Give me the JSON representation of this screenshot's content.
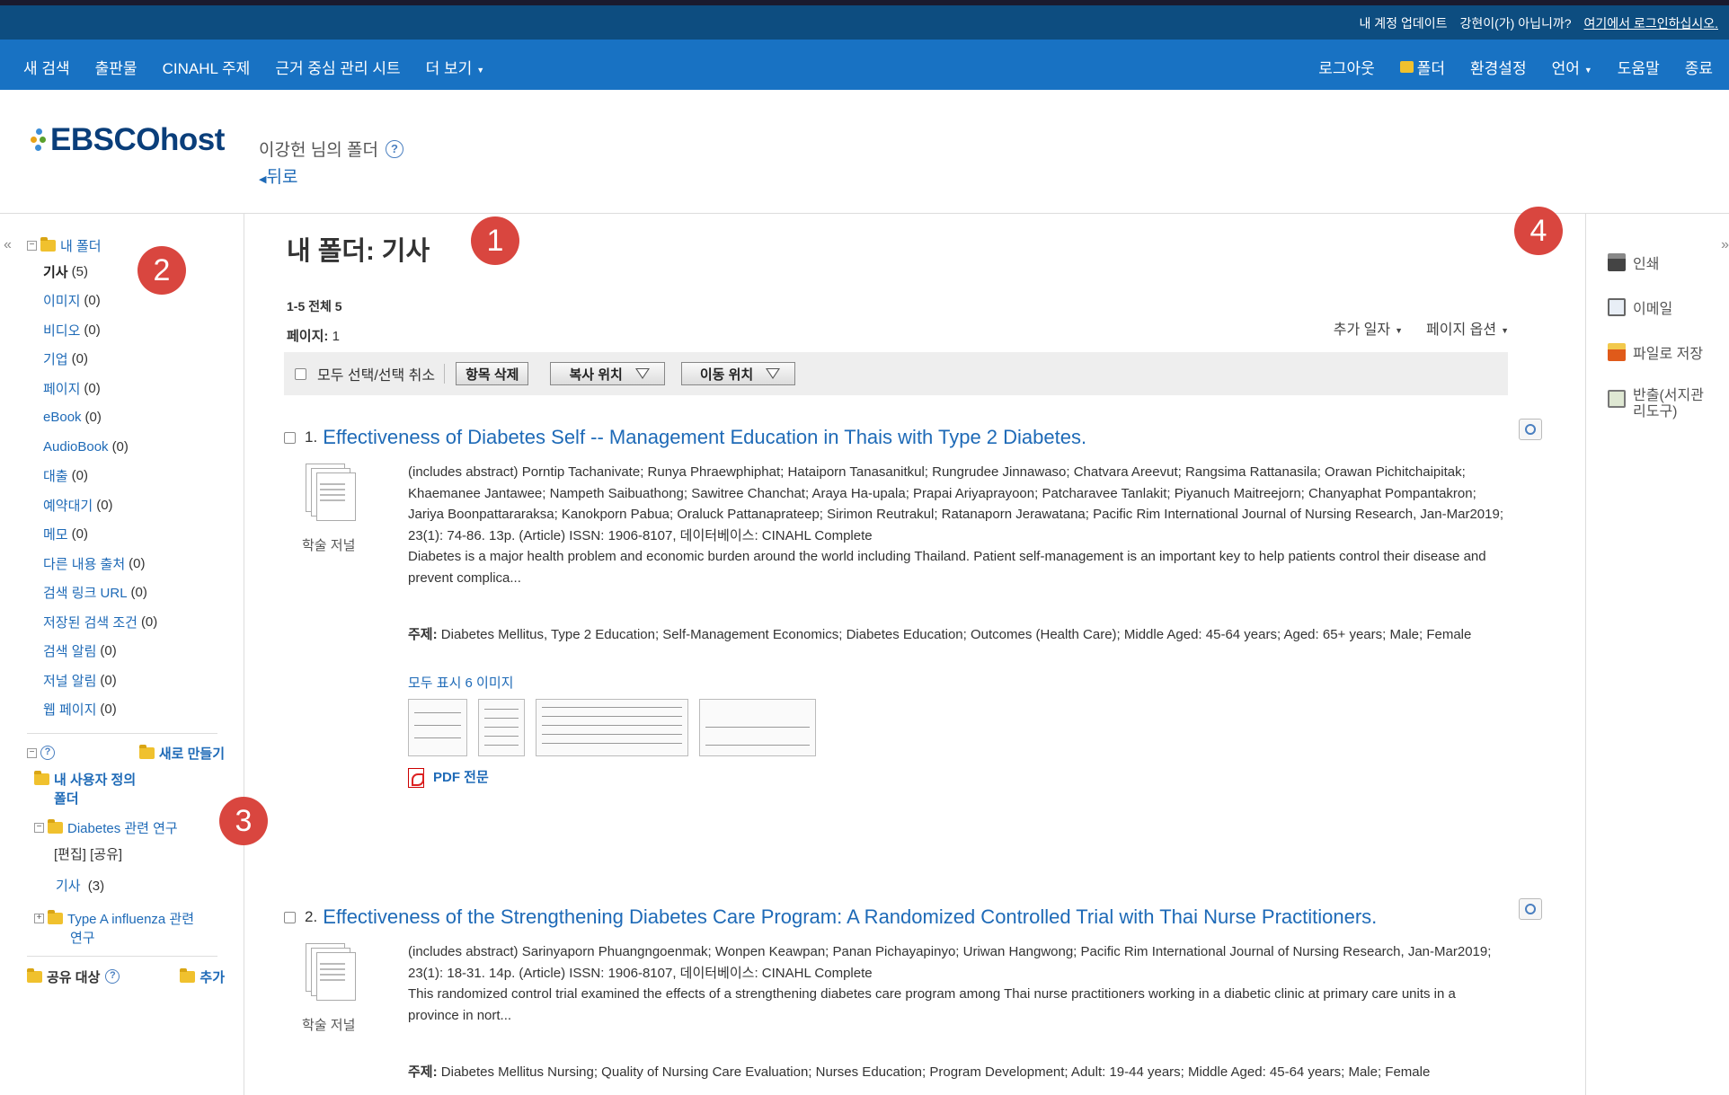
{
  "utilbar": {
    "update_account": "내 계정 업데이트",
    "not_user": "강현이(가) 아닙니까?",
    "login_here": "여기에서 로그인하십시오."
  },
  "nav": {
    "left": [
      "새 검색",
      "출판물",
      "CINAHL 주제",
      "근거 중심 관리 시트",
      "더 보기"
    ],
    "right": [
      "로그아웃",
      "폴더",
      "환경설정",
      "언어",
      "도움말",
      "종료"
    ]
  },
  "header": {
    "logo": "EBSCOhost",
    "folder_title": "이강헌 님의 폴더",
    "help": "?",
    "back": "뒤로"
  },
  "sidebar": {
    "collapse": "«",
    "my_folder": "내 폴더",
    "items": [
      {
        "label": "기사",
        "count": "(5)",
        "active": true
      },
      {
        "label": "이미지",
        "count": "(0)"
      },
      {
        "label": "비디오",
        "count": "(0)"
      },
      {
        "label": "기업",
        "count": "(0)"
      },
      {
        "label": "페이지",
        "count": "(0)"
      },
      {
        "label": "eBook",
        "count": "(0)"
      },
      {
        "label": "AudioBook",
        "count": "(0)"
      },
      {
        "label": "대출",
        "count": "(0)"
      },
      {
        "label": "예약대기",
        "count": "(0)"
      },
      {
        "label": "메모",
        "count": "(0)"
      },
      {
        "label": "다른 내용 출처",
        "count": "(0)"
      },
      {
        "label": "검색 링크 URL",
        "count": "(0)"
      },
      {
        "label": "저장된 검색 조건",
        "count": "(0)"
      },
      {
        "label": "검색 알림",
        "count": "(0)"
      },
      {
        "label": "저널 알림",
        "count": "(0)"
      },
      {
        "label": "웹 페이지",
        "count": "(0)"
      }
    ],
    "new_folder": "새로 만들기",
    "custom_folder_line1": "내 사용자 정의",
    "custom_folder_line2": "폴더",
    "diabetes_folder": "Diabetes 관련 연구",
    "edit_share": "[편집] [공유]",
    "articles_sub": "기사",
    "articles_sub_count": "(3)",
    "influenza_line1": "Type A influenza 관련",
    "influenza_line2": "연구",
    "shared": "공유 대상",
    "add": "추가"
  },
  "main": {
    "title": "내 폴더: 기사",
    "result_count": "1-5 전체 5",
    "page_label": "페이지:",
    "page_value": "1",
    "sort_date": "추가 일자",
    "page_options": "페이지 옵션",
    "select_all": "모두 선택/선택 취소",
    "delete": "항목 삭제",
    "copy_to": "복사 위치",
    "move_to": "이동 위치"
  },
  "results": [
    {
      "num": "1.",
      "title": "Effectiveness of Diabetes Self -- Management Education in Thais with Type 2 Diabetes.",
      "type_label": "학술 저널",
      "authors": "(includes abstract) Porntip Tachanivate; Runya Phraewphiphat; Hataiporn Tanasanitkul; Rungrudee Jinnawaso; Chatvara Areevut; Rangsima Rattanasila; Orawan Pichitchaipitak; Khaemanee Jantawee; Nampeth Saibuathong; Sawitree Chanchat; Araya Ha-upala; Prapai Ariyaprayoon; Patcharavee Tanlakit; Piyanuch Maitreejorn; Chanyaphat Pompantakron; Jariya Boonpattararaksa; Kanokporn Pabua; Oraluck Pattanaprateep; Sirimon Reutrakul; Ratanaporn Jerawatana; Pacific Rim International Journal of Nursing Research, Jan-Mar2019; 23(1): 74-86. 13p. (Article) ISSN: 1906-8107, 데이터베이스: CINAHL Complete",
      "abstract": "Diabetes is a major health problem and economic burden around the world including Thailand. Patient self-management is an important key to help patients control their disease and prevent complica...",
      "subject_label": "주제:",
      "subjects": "Diabetes Mellitus, Type 2 Education; Self-Management Economics; Diabetes Education; Outcomes (Health Care); Middle Aged: 45-64 years; Aged: 65+ years; Male; Female",
      "show_images": "모두 표시 6 이미지",
      "pdf": "PDF 전문"
    },
    {
      "num": "2.",
      "title": "Effectiveness of the Strengthening Diabetes Care Program: A Randomized Controlled Trial with Thai Nurse Practitioners.",
      "type_label": "학술 저널",
      "authors": "(includes abstract) Sarinyaporn Phuangngoenmak; Wonpen Keawpan; Panan Pichayapinyo; Uriwan Hangwong; Pacific Rim International Journal of Nursing Research, Jan-Mar2019; 23(1): 18-31. 14p. (Article) ISSN: 1906-8107, 데이터베이스: CINAHL Complete",
      "abstract": "This randomized control trial examined the effects of a strengthening diabetes care program among Thai nurse practitioners working in a diabetic clinic at primary care units in a province in nort...",
      "subject_label": "주제:",
      "subjects": "Diabetes Mellitus Nursing; Quality of Nursing Care Evaluation; Nurses Education; Program Development; Adult: 19-44 years; Middle Aged: 45-64 years; Male; Female"
    }
  ],
  "tools": {
    "collapse": "»",
    "print": "인쇄",
    "email": "이메일",
    "save_file": "파일로 저장",
    "export_line1": "반출(서지관",
    "export_line2": "리도구)"
  },
  "callouts": [
    "1",
    "2",
    "3",
    "4"
  ],
  "colors": {
    "utilbar": "#0d4d80",
    "mainnav": "#1872c3",
    "link": "#1e6ab7",
    "callout": "#d9463f"
  }
}
